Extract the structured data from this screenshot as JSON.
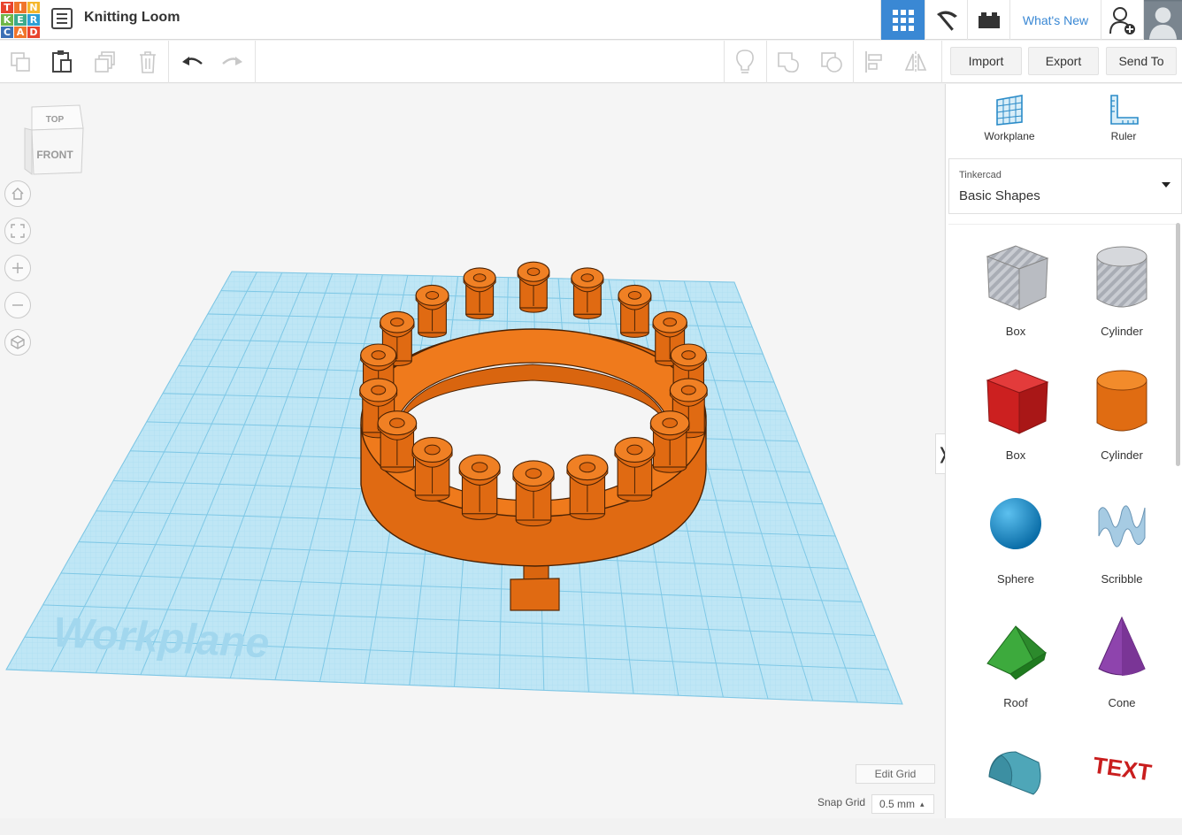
{
  "app": {
    "logo_letters": [
      "T",
      "I",
      "N",
      "K",
      "E",
      "R",
      "C",
      "A",
      "D"
    ],
    "logo_colors": [
      "#e8442e",
      "#f0752b",
      "#f5b62b",
      "#6fb649",
      "#3cab8c",
      "#2d9fd6",
      "#3a6fb5",
      "#f0752b",
      "#e8442e"
    ],
    "design_title": "Knitting Loom"
  },
  "header": {
    "whats_new": "What's New",
    "accent_color": "#3a88d4"
  },
  "toolbar": {
    "import_label": "Import",
    "export_label": "Export",
    "send_to_label": "Send To"
  },
  "viewcube": {
    "top_label": "TOP",
    "front_label": "FRONT"
  },
  "workplane": {
    "label": "Workplane",
    "grid_color": "#a8dbee"
  },
  "model": {
    "color": "#ea7417"
  },
  "grid_controls": {
    "edit_grid": "Edit Grid",
    "snap_label": "Snap Grid",
    "snap_value": "0.5 mm"
  },
  "sidebar": {
    "tools": [
      "Workplane",
      "Ruler"
    ],
    "library_source": "Tinkercad",
    "library_name": "Basic Shapes",
    "shapes": [
      {
        "label": "Box",
        "icon": "box-hole-icon"
      },
      {
        "label": "Cylinder",
        "icon": "cylinder-hole-icon"
      },
      {
        "label": "Box",
        "icon": "box-red-icon"
      },
      {
        "label": "Cylinder",
        "icon": "cylinder-orange-icon"
      },
      {
        "label": "Sphere",
        "icon": "sphere-icon"
      },
      {
        "label": "Scribble",
        "icon": "scribble-icon"
      },
      {
        "label": "Roof",
        "icon": "roof-icon"
      },
      {
        "label": "Cone",
        "icon": "cone-icon"
      },
      {
        "label": "",
        "icon": "round-roof-icon"
      },
      {
        "label": "",
        "icon": "text-icon"
      }
    ]
  }
}
